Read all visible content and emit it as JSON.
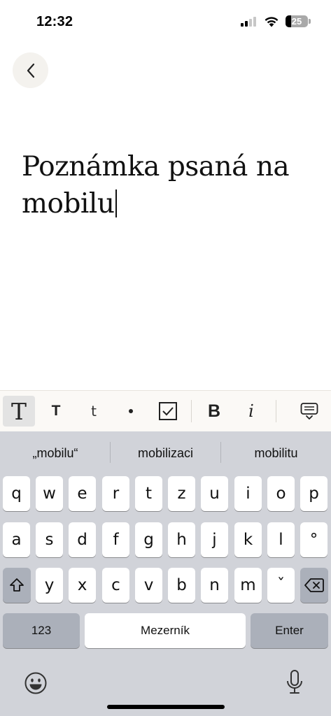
{
  "status_bar": {
    "time": "12:32",
    "battery_percent": "25",
    "signal_bars_active": 2,
    "signal_bars_total": 4
  },
  "navigation": {
    "back_icon": "chevron-left-icon"
  },
  "note": {
    "text": "Poznámka psaná na mobilu"
  },
  "format_toolbar": {
    "heading_large_label": "T",
    "heading_small_label": "T",
    "body_text_label": "t",
    "bold_label": "B",
    "italic_label": "i",
    "icons": [
      "bullet-list-icon",
      "checkbox-icon",
      "keyboard-hide-icon"
    ],
    "active_item": "heading_large"
  },
  "keyboard": {
    "suggestions": [
      "„mobilu“",
      "mobilizaci",
      "mobilitu"
    ],
    "row1": [
      "q",
      "w",
      "e",
      "r",
      "t",
      "z",
      "u",
      "i",
      "o",
      "p"
    ],
    "row2": [
      "a",
      "s",
      "d",
      "f",
      "g",
      "h",
      "j",
      "k",
      "l",
      "°"
    ],
    "row3": [
      "y",
      "x",
      "c",
      "v",
      "b",
      "n",
      "m",
      "ˇ"
    ],
    "numbers_label": "123",
    "space_label": "Mezerník",
    "enter_label": "Enter",
    "icons": [
      "shift-icon",
      "backspace-icon",
      "emoji-icon",
      "microphone-icon"
    ]
  },
  "colors": {
    "keyboard_background": "#d1d3d9",
    "key_background": "#ffffff",
    "function_key_background": "#abb0ba",
    "toolbar_background": "#fbf9f6",
    "back_button_background": "#f4f2ee"
  }
}
